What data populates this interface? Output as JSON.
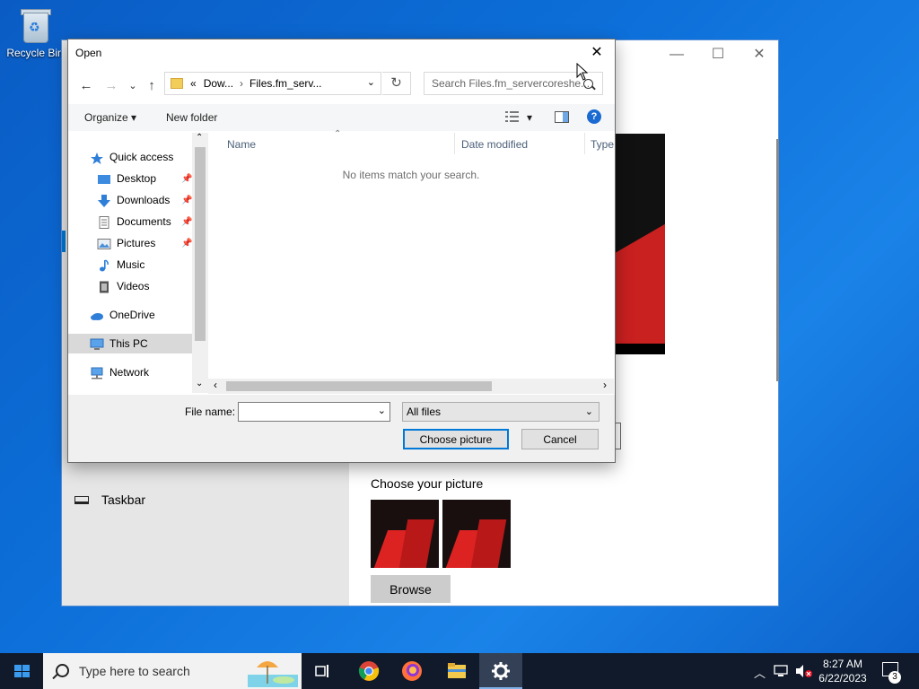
{
  "desktop": {
    "recycle_bin_label": "Recycle Bin"
  },
  "settings_window": {
    "minimize": "—",
    "maximize": "☐",
    "close": "✕",
    "taskbar_item_label": "Taskbar",
    "choose_picture_title": "Choose your picture",
    "browse_label": "Browse"
  },
  "dialog": {
    "title": "Open",
    "close": "✕",
    "nav": {
      "back": "←",
      "forward": "→",
      "recent": "⌄",
      "up": "↑"
    },
    "address": {
      "overflow": "«",
      "crumb_1": "Dow...",
      "crumb_2": "Files.fm_serv...",
      "chevron": "›",
      "dropdown": "⌄"
    },
    "refresh": "↻",
    "search_placeholder": "Search Files.fm_servercoreshe...",
    "toolbar": {
      "organize": "Organize ▾",
      "new_folder": "New folder",
      "view_menu": "▾",
      "help": "?"
    },
    "nav_pane": {
      "quick_access": "Quick access",
      "desktop": "Desktop",
      "downloads": "Downloads",
      "documents": "Documents",
      "pictures": "Pictures",
      "music": "Music",
      "videos": "Videos",
      "onedrive": "OneDrive",
      "this_pc": "This PC",
      "network": "Network",
      "scroll_up": "⌃",
      "scroll_down": "⌄"
    },
    "columns": {
      "name": "Name",
      "date_modified": "Date modified",
      "type": "Type",
      "sort": "⌃"
    },
    "empty_message": "No items match your search.",
    "hscroll": {
      "left": "‹",
      "right": "›"
    },
    "file_name_label": "File name:",
    "file_name_value": "",
    "file_name_dropdown": "⌄",
    "file_type": "All files",
    "file_type_dropdown": "⌄",
    "choose_button": "Choose picture",
    "cancel_button": "Cancel"
  },
  "taskbar": {
    "search_placeholder": "Type here to search",
    "tray_chevron": "︿",
    "time": "8:27 AM",
    "date": "6/22/2023",
    "notification_count": "3"
  }
}
